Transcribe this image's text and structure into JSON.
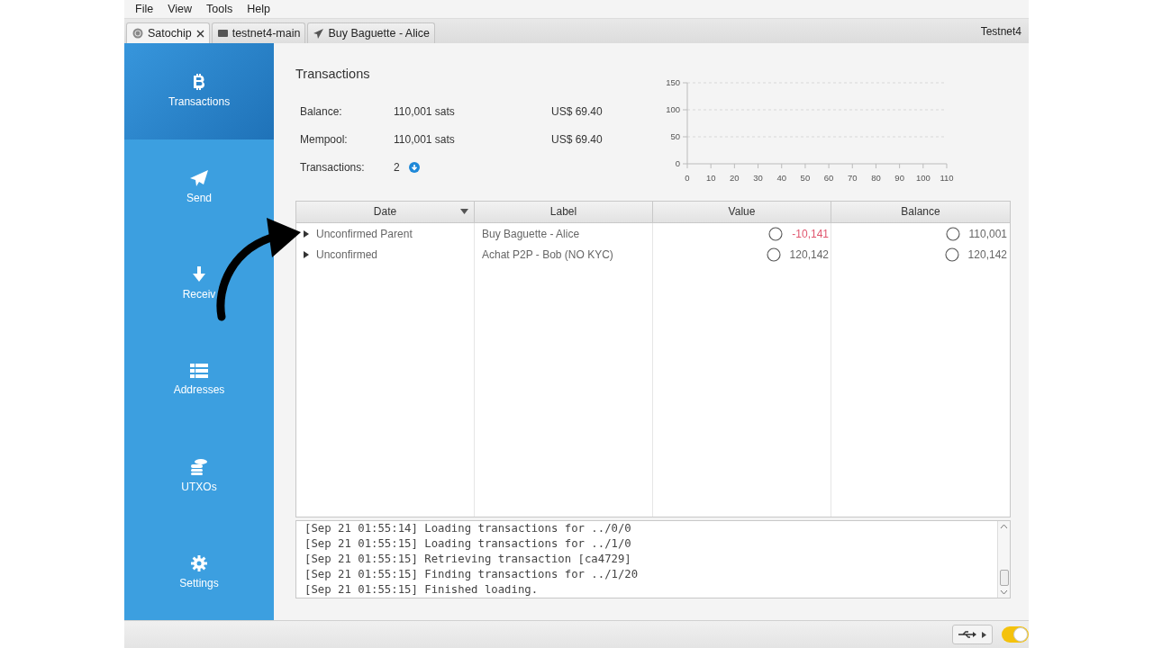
{
  "menu": [
    "File",
    "View",
    "Tools",
    "Help"
  ],
  "tabs": [
    {
      "label": "Satochip",
      "selected": true,
      "closable": true
    },
    {
      "label": "testnet4-main",
      "selected": false,
      "closable": false
    },
    {
      "label": "Buy Baguette - Alice",
      "selected": false,
      "closable": false
    }
  ],
  "network": "Testnet4",
  "sidebar": {
    "items": [
      {
        "label": "Transactions",
        "selected": true
      },
      {
        "label": "Send",
        "selected": false
      },
      {
        "label": "Receiv",
        "selected": false
      },
      {
        "label": "Addresses",
        "selected": false
      },
      {
        "label": "UTXOs",
        "selected": false
      },
      {
        "label": "Settings",
        "selected": false
      }
    ]
  },
  "title": "Transactions",
  "summary": [
    {
      "label": "Balance:",
      "value": "110,001 sats",
      "fiat": "US$ 69.40"
    },
    {
      "label": "Mempool:",
      "value": "110,001 sats",
      "fiat": "US$ 69.40"
    },
    {
      "label": "Transactions:",
      "value": "2"
    }
  ],
  "chart": {
    "chart_data": {
      "type": "line",
      "xlim": [
        0,
        110
      ],
      "ylim": [
        0,
        150
      ],
      "xticks": [
        0,
        10,
        20,
        30,
        40,
        50,
        60,
        70,
        80,
        90,
        100,
        110
      ],
      "yticks": [
        0,
        50,
        100,
        150
      ]
    }
  },
  "table": {
    "columns": [
      "Date",
      "Label",
      "Value",
      "Balance"
    ],
    "rows": [
      {
        "date": "Unconfirmed Parent",
        "label": "Buy Baguette - Alice",
        "value": "-10,141",
        "negative": true,
        "balance": "110,001",
        "expanded": false
      },
      {
        "date": "Unconfirmed",
        "label": "Achat P2P - Bob (NO KYC)",
        "value": "120,142",
        "negative": false,
        "balance": "120,142",
        "expanded": false
      }
    ]
  },
  "log": [
    "[Sep 21 01:55:14] Loading transactions for ../0/0",
    "[Sep 21 01:55:15] Loading transactions for ../1/0",
    "[Sep 21 01:55:15] Retrieving transaction [ca4729]",
    "[Sep 21 01:55:15] Finding transactions for ../1/20",
    "[Sep 21 01:55:15] Finished loading."
  ],
  "status_bar": {
    "toggle_on": true
  }
}
